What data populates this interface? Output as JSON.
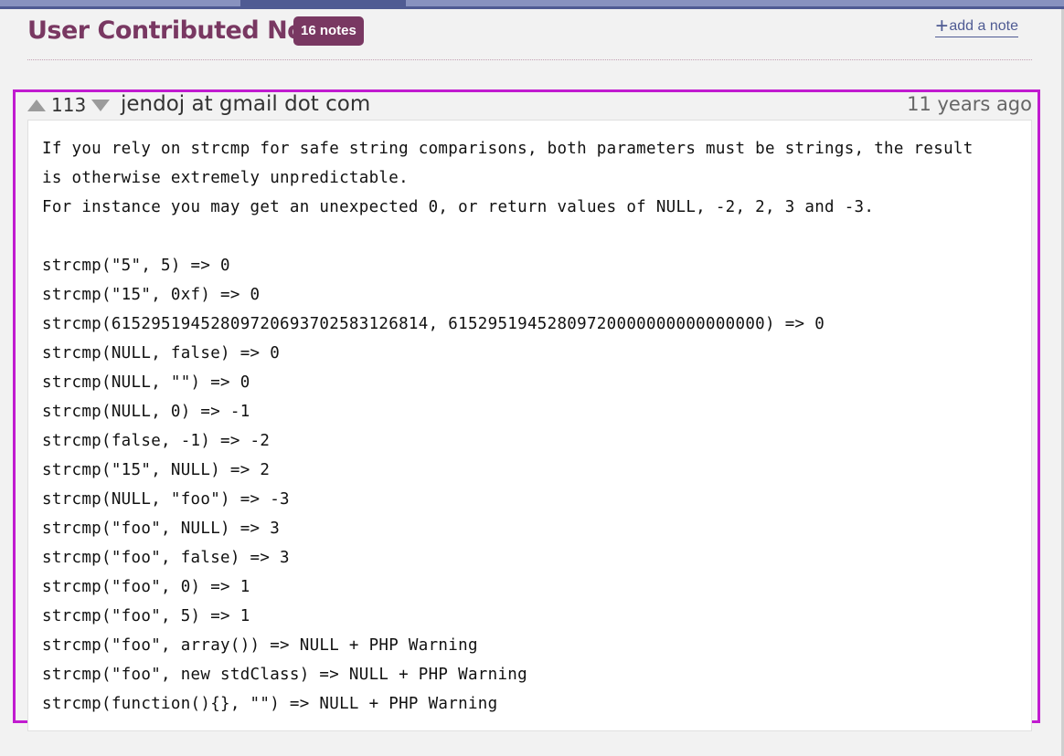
{
  "header": {
    "title": "User Contributed Notes",
    "count_badge": "16 notes",
    "add_note_label": "add a note"
  },
  "note": {
    "score": "113",
    "author": "jendoj at gmail dot com",
    "date": "11 years ago",
    "lines": [
      "If you rely on strcmp for safe string comparisons, both parameters must be strings, the result",
      "is otherwise extremely unpredictable.",
      "For instance you may get an unexpected 0, or return values of NULL, -2, 2, 3 and -3.",
      "",
      "strcmp(\"5\", 5) => 0",
      "strcmp(\"15\", 0xf) => 0",
      "strcmp(61529519452809720693702583126814, 61529519452809720000000000000000) => 0",
      "strcmp(NULL, false) => 0",
      "strcmp(NULL, \"\") => 0",
      "strcmp(NULL, 0) => -1",
      "strcmp(false, -1) => -2",
      "strcmp(\"15\", NULL) => 2",
      "strcmp(NULL, \"foo\") => -3",
      "strcmp(\"foo\", NULL) => 3",
      "strcmp(\"foo\", false) => 3",
      "strcmp(\"foo\", 0) => 1",
      "strcmp(\"foo\", 5) => 1",
      "strcmp(\"foo\", array()) => NULL + PHP Warning",
      "strcmp(\"foo\", new stdClass) => NULL + PHP Warning",
      "strcmp(function(){}, \"\") => NULL + PHP Warning"
    ]
  },
  "icons": {
    "add": "plus-icon",
    "vote_up": "triangle-up-icon",
    "vote_down": "triangle-down-icon"
  },
  "colors": {
    "accent": "#793862",
    "link": "#4f5b93",
    "highlight_frame": "#c11bd0",
    "nav": "#8892bf"
  }
}
